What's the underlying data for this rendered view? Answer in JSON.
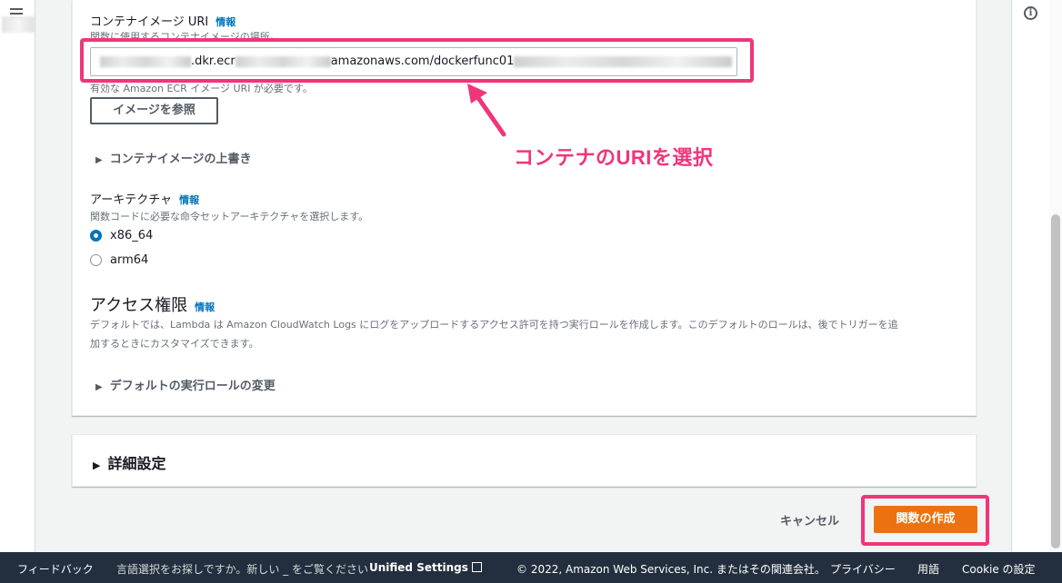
{
  "form": {
    "uri_label": "コンテナイメージ URI",
    "info_link": "情報",
    "uri_desc": "関数に使用するコンテナイメージの場所。",
    "uri_value_mid": ".dkr.ecr",
    "uri_value_end": "amazonaws.com/dockerfunc01",
    "uri_hint": "有効な Amazon ECR イメージ URI が必要です。",
    "browse_button": "イメージを参照",
    "override_section": "コンテナイメージの上書き",
    "arch_label": "アーキテクチャ",
    "arch_desc": "関数コードに必要な命令セットアーキテクチャを選択します。",
    "arch_options": [
      {
        "label": "x86_64",
        "selected": true
      },
      {
        "label": "arm64",
        "selected": false
      }
    ],
    "access_heading": "アクセス権限",
    "access_desc_line1": "デフォルトでは、Lambda は Amazon CloudWatch Logs にログをアップロードするアクセス許可を持つ実行ロールを作成します。このデフォルトのロールは、後でトリガーを追",
    "access_desc_line2": "加するときにカスタマイズできます。",
    "role_section": "デフォルトの実行ロールの変更",
    "advanced_section": "詳細設定",
    "cancel": "キャンセル",
    "create_button": "関数の作成"
  },
  "annotation": {
    "text": "コンテナのURIを選択",
    "color": "#f0357a"
  },
  "footer": {
    "feedback": "フィードバック",
    "lang_prompt": "言語選択をお探しですか。新しい _ をご覧ください",
    "unified": "Unified Settings",
    "copyright": "© 2022, Amazon Web Services, Inc. またはその関連会社。",
    "privacy": "プライバシー",
    "terms": "用語",
    "cookie": "Cookie の設定"
  },
  "colors": {
    "accent": "#ec7211",
    "link": "#0073bb",
    "footer_bg": "#232f3e"
  }
}
